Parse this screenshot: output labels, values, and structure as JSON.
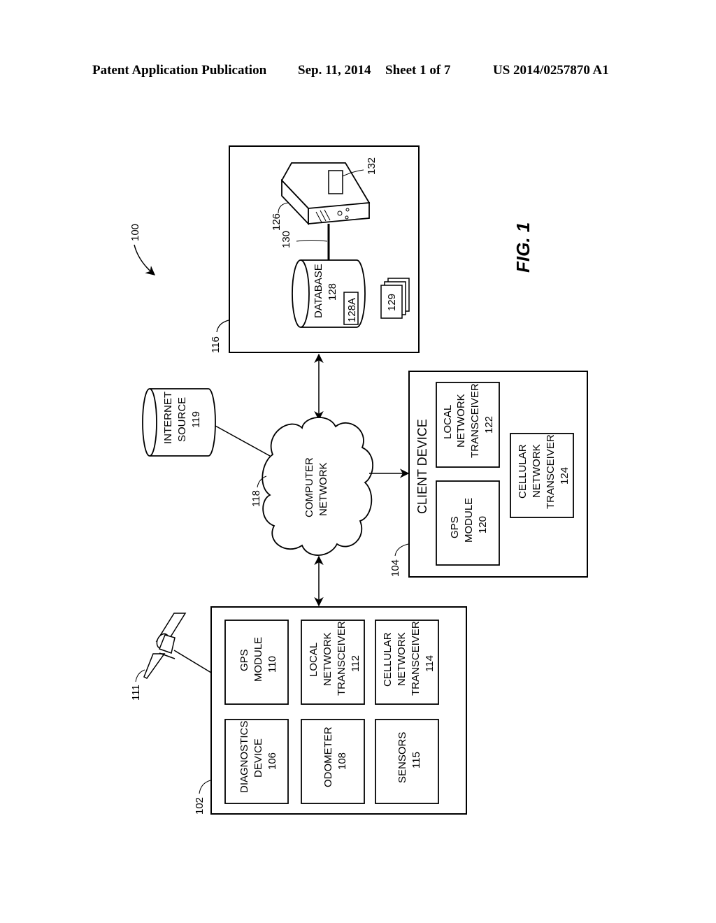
{
  "header": {
    "left": "Patent Application Publication",
    "date": "Sep. 11, 2014",
    "sheet": "Sheet 1 of 7",
    "number": "US 2014/0257870 A1"
  },
  "figure": {
    "label": "FIG. 1",
    "system_ref": "100",
    "server_group": {
      "ref": "116",
      "server_ref": "126",
      "server_display_ref": "132",
      "link_ref": "130",
      "database": {
        "lines": [
          "DATABASE",
          "128"
        ],
        "sub_ref": "128A"
      },
      "documents_ref": "129"
    },
    "internet_source": {
      "lines": [
        "INTERNET",
        "SOURCE",
        "119"
      ]
    },
    "network": {
      "ref": "118",
      "lines": [
        "COMPUTER",
        "NETWORK"
      ]
    },
    "client_device": {
      "ref": "104",
      "title": "CLIENT DEVICE",
      "modules": [
        {
          "lines": [
            "GPS",
            "MODULE",
            "120"
          ]
        },
        {
          "lines": [
            "LOCAL",
            "NETWORK",
            "TRANSCEIVER",
            "122"
          ]
        },
        {
          "lines": [
            "CELLULAR",
            "NETWORK",
            "TRANSCEIVER",
            "124"
          ]
        }
      ]
    },
    "vehicle_device": {
      "ref": "102",
      "satellite_ref": "111",
      "modules": [
        {
          "lines": [
            "GPS",
            "MODULE",
            "110"
          ]
        },
        {
          "lines": [
            "LOCAL",
            "NETWORK",
            "TRANSCEIVER",
            "112"
          ]
        },
        {
          "lines": [
            "CELLULAR",
            "NETWORK",
            "TRANSCEIVER",
            "114"
          ]
        },
        {
          "lines": [
            "DIAGNOSTICS",
            "DEVICE",
            "106"
          ]
        },
        {
          "lines": [
            "ODOMETER",
            "108"
          ]
        },
        {
          "lines": [
            "SENSORS",
            "115"
          ]
        }
      ]
    }
  }
}
